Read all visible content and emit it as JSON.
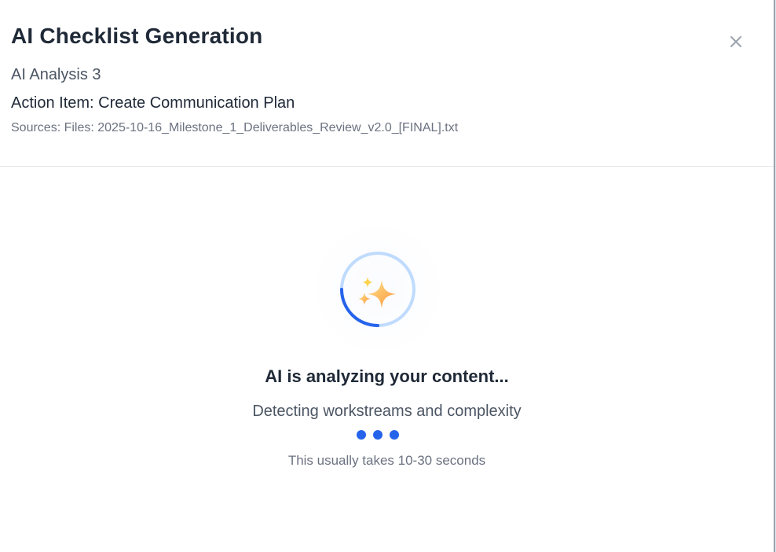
{
  "modal": {
    "title": "AI Checklist Generation",
    "subtitle": "AI Analysis 3",
    "action_item": "Action Item: Create Communication Plan",
    "sources": "Sources: Files: 2025-10-16_Milestone_1_Deliverables_Review_v2.0_[FINAL].txt",
    "close_icon": "close-icon"
  },
  "status": {
    "title": "AI is analyzing your content...",
    "detail": "Detecting workstreams and complexity",
    "hint": "This usually takes 10-30 seconds",
    "loader_icon": "sparkle-icon",
    "progress_dots": 3
  },
  "colors": {
    "accent": "#2563eb",
    "spinner_track": "#bfdbfe",
    "sparkle_light": "#fde68a",
    "sparkle_dark": "#fb923c",
    "text_primary": "#1f2937",
    "text_secondary": "#4b5563",
    "text_muted": "#6b7280"
  }
}
